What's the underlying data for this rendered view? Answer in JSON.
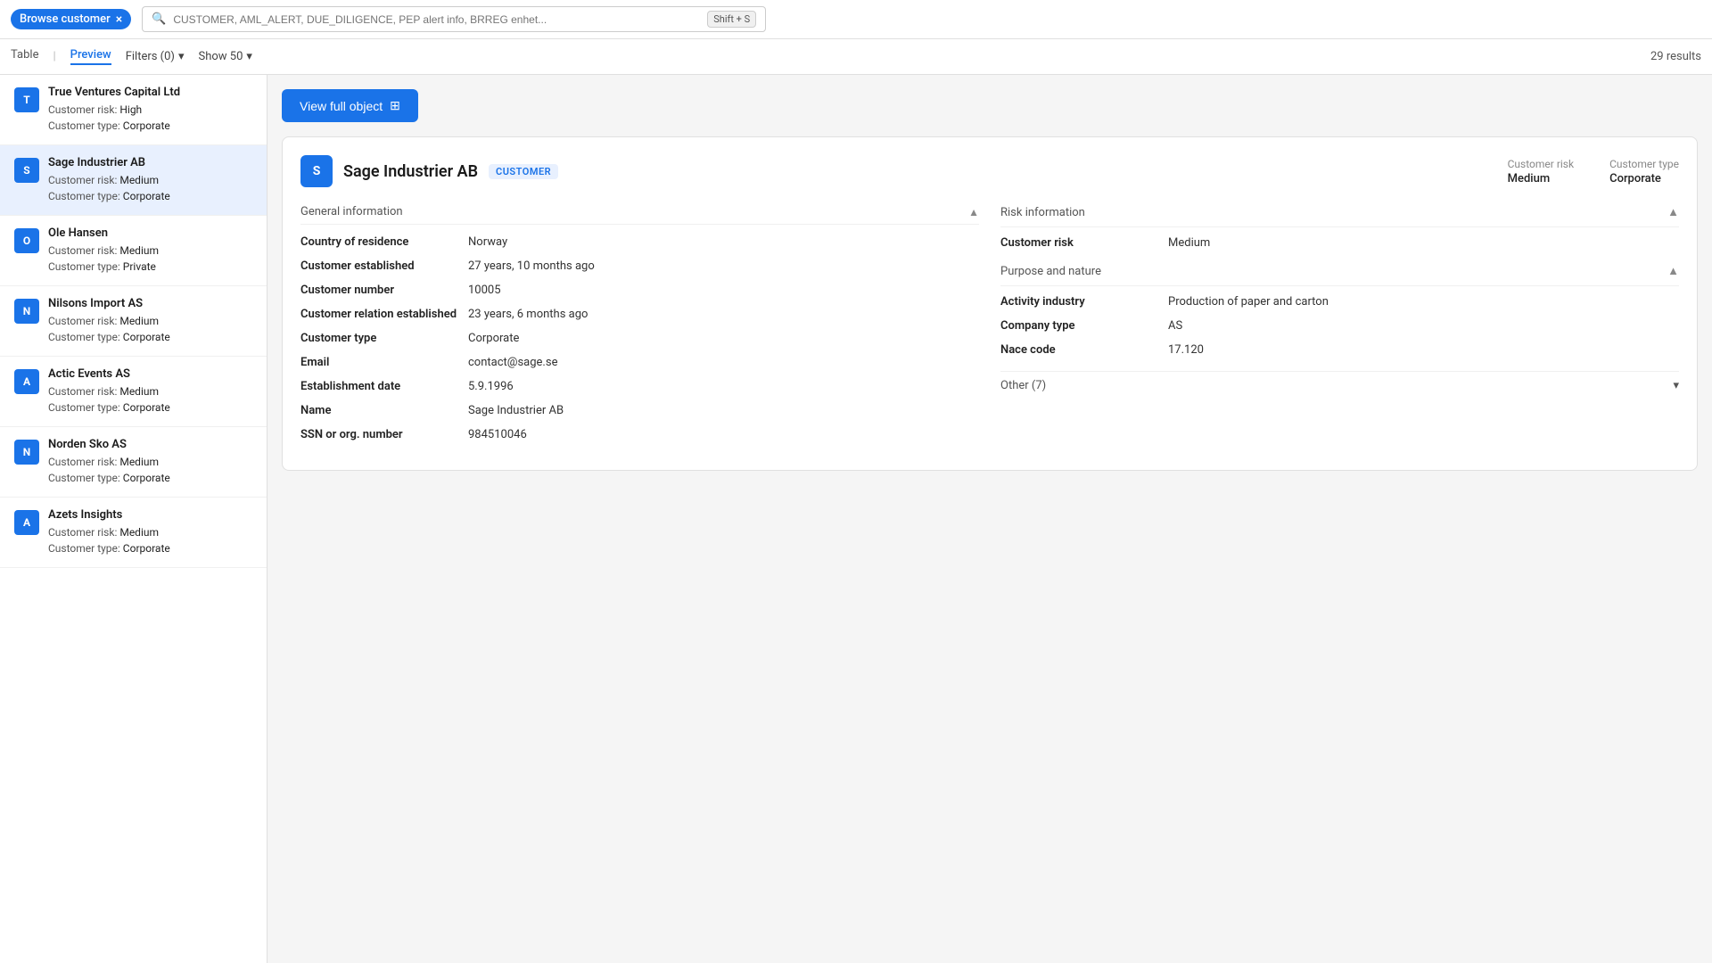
{
  "top_bar": {
    "tab_label": "Browse customer",
    "close_icon": "×",
    "search_placeholder": "CUSTOMER, AML_ALERT, DUE_DILIGENCE, PEP alert info, BRREG enhet...",
    "shortcut": "Shift + S"
  },
  "sub_bar": {
    "tabs": [
      {
        "id": "table",
        "label": "Table"
      },
      {
        "id": "preview",
        "label": "Preview",
        "active": true
      }
    ],
    "divider": "|",
    "filters_label": "Filters (0)",
    "show_label": "Show 50",
    "results_label": "29 results"
  },
  "sidebar": {
    "customers": [
      {
        "id": 1,
        "initial": "T",
        "name": "True Ventures Capital Ltd",
        "risk_label": "Customer risk:",
        "risk_value": "High",
        "type_label": "Customer type:",
        "type_value": "Corporate",
        "selected": false
      },
      {
        "id": 2,
        "initial": "S",
        "name": "Sage Industrier AB",
        "risk_label": "Customer risk:",
        "risk_value": "Medium",
        "type_label": "Customer type:",
        "type_value": "Corporate",
        "selected": true
      },
      {
        "id": 3,
        "initial": "O",
        "name": "Ole Hansen",
        "risk_label": "Customer risk:",
        "risk_value": "Medium",
        "type_label": "Customer type:",
        "type_value": "Private",
        "selected": false
      },
      {
        "id": 4,
        "initial": "N",
        "name": "Nilsons Import AS",
        "risk_label": "Customer risk:",
        "risk_value": "Medium",
        "type_label": "Customer type:",
        "type_value": "Corporate",
        "selected": false
      },
      {
        "id": 5,
        "initial": "A",
        "name": "Actic Events AS",
        "risk_label": "Customer risk:",
        "risk_value": "Medium",
        "type_label": "Customer type:",
        "type_value": "Corporate",
        "selected": false
      },
      {
        "id": 6,
        "initial": "N",
        "name": "Norden Sko AS",
        "risk_label": "Customer risk:",
        "risk_value": "Medium",
        "type_label": "Customer type:",
        "type_value": "Corporate",
        "selected": false
      },
      {
        "id": 7,
        "initial": "A",
        "name": "Azets Insights",
        "risk_label": "Customer risk:",
        "risk_value": "Medium",
        "type_label": "Customer type:",
        "type_value": "Corporate",
        "selected": false
      }
    ]
  },
  "detail": {
    "view_full_label": "View full object",
    "company_name": "Sage Industrier AB",
    "badge": "CUSTOMER",
    "customer_risk_label": "Customer risk",
    "customer_risk_value": "Medium",
    "customer_type_label": "Customer type",
    "customer_type_value": "Corporate",
    "general_info_label": "General information",
    "fields": [
      {
        "label": "Country of residence",
        "value": "Norway"
      },
      {
        "label": "Customer established",
        "value": "27 years, 10 months ago"
      },
      {
        "label": "Customer number",
        "value": "10005"
      },
      {
        "label": "Customer relation established",
        "value": "23 years, 6 months ago"
      },
      {
        "label": "Customer type",
        "value": "Corporate"
      },
      {
        "label": "Email",
        "value": "contact@sage.se"
      },
      {
        "label": "Establishment date",
        "value": "5.9.1996"
      },
      {
        "label": "Name",
        "value": "Sage Industrier AB"
      },
      {
        "label": "SSN or org. number",
        "value": "984510046"
      }
    ],
    "risk_info_label": "Risk information",
    "risk_fields": [
      {
        "label": "Customer risk",
        "value": "Medium"
      }
    ],
    "purpose_label": "Purpose and nature",
    "purpose_fields": [
      {
        "label": "Activity industry",
        "value": "Production of paper and carton"
      },
      {
        "label": "Company type",
        "value": "AS"
      },
      {
        "label": "Nace code",
        "value": "17.120"
      }
    ],
    "other_label": "Other (7)"
  },
  "icons": {
    "search": "🔍",
    "view_object": "⊞",
    "chevron_up": "▲",
    "chevron_down": "▼",
    "close": "×"
  }
}
